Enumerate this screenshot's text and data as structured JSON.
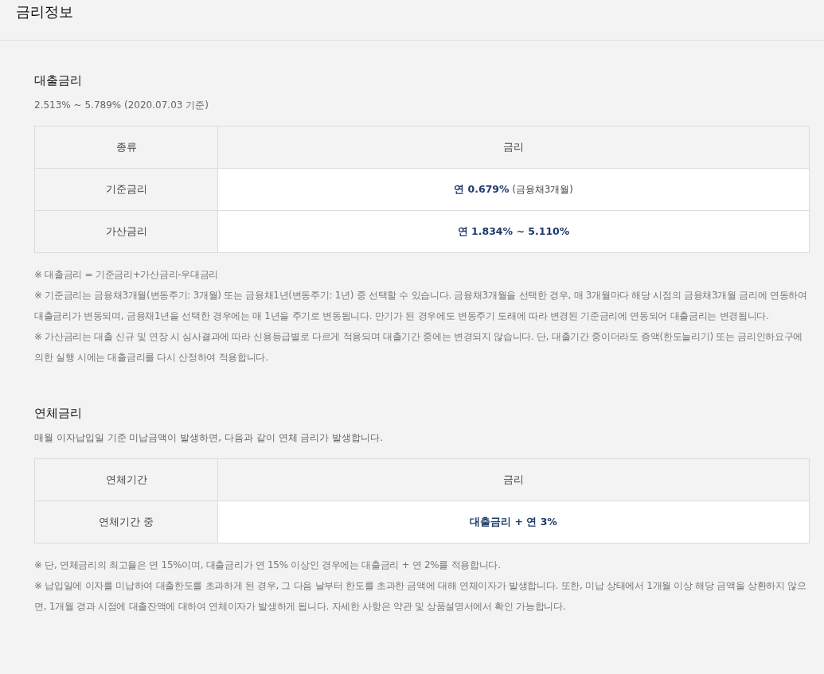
{
  "header": {
    "title": "금리정보"
  },
  "sections": [
    {
      "heading": "대출금리",
      "summary": "2.513% ~ 5.789% (2020.07.03 기준)",
      "table": {
        "columns": [
          "종류",
          "금리"
        ],
        "rows": [
          {
            "label": "기준금리",
            "value": "연 0.679%",
            "note": "(금융채3개월)"
          },
          {
            "label": "가산금리",
            "value": "연 1.834% ~ 5.110%"
          }
        ]
      },
      "notes": [
        "※ 대출금리 = 기준금리+가산금리-우대금리",
        "※ 기준금리는 금융채3개월(변동주기: 3개월) 또는 금융채1년(변동주기: 1년) 중 선택할 수 있습니다. 금융채3개월을 선택한 경우, 매 3개월마다 해당 시점의 금융채3개월 금리에 연동하여 대출금리가 변동되며, 금융채1년을 선택한 경우에는 매 1년을 주기로 변동됩니다. 만기가 된 경우에도 변동주기 도래에 따라 변경된 기준금리에 연동되어 대출금리는 변경됩니다.",
        "※ 가산금리는 대출 신규 및 연장 시 심사결과에 따라 신용등급별로 다르게 적용되며 대출기간 중에는 변경되지 않습니다. 단, 대출기간 중이더라도 증액(한도늘리기) 또는 금리인하요구에 의한 실행 시에는 대출금리를 다시 산정하여 적용합니다."
      ]
    },
    {
      "heading": "연체금리",
      "summary": "매월 이자납입일 기준 미납금액이 발생하면, 다음과 같이 연체 금리가 발생합니다.",
      "table": {
        "columns": [
          "연체기간",
          "금리"
        ],
        "rows": [
          {
            "label": "연체기간 중",
            "value": "대출금리 + 연 3%"
          }
        ]
      },
      "notes": [
        "※ 단, 연체금리의 최고율은 연 15%이며, 대출금리가 연 15% 이상인 경우에는 대출금리 + 연 2%를 적용합니다.",
        "※ 납입일에 이자를 미납하여 대출한도를 초과하게 된 경우, 그 다음 날부터 한도를 초과한 금액에 대해 연체이자가 발생합니다. 또한, 미납 상태에서 1개월 이상 해당 금액을 상환하지 않으면, 1개월 경과 시점에 대출잔액에 대하여 연체이자가 발생하게 됩니다. 자세한 사항은 약관 및 상품설명서에서 확인 가능합니다."
      ]
    }
  ]
}
